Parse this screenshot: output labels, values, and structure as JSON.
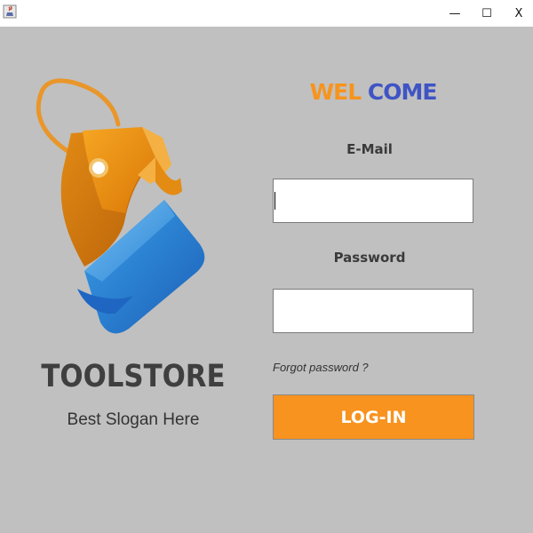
{
  "titlebar": {
    "app_icon": "java-cup-icon",
    "minimize_glyph": "—",
    "maximize_glyph": "☐",
    "close_glyph": "X"
  },
  "brand": {
    "name": "TOOLSTORE",
    "slogan": "Best Slogan Here",
    "logo_icon": "tag-wrench-icon"
  },
  "welcome": {
    "part1": "WEL",
    "part2": "COME"
  },
  "form": {
    "email_label": "E-Mail",
    "email_value": "",
    "password_label": "Password",
    "password_value": "",
    "forgot_text": "Forgot password ?",
    "login_label": "LOG-IN"
  },
  "colors": {
    "background": "#c0c0c0",
    "accent_orange": "#f7931e",
    "accent_blue": "#3f54c4"
  }
}
